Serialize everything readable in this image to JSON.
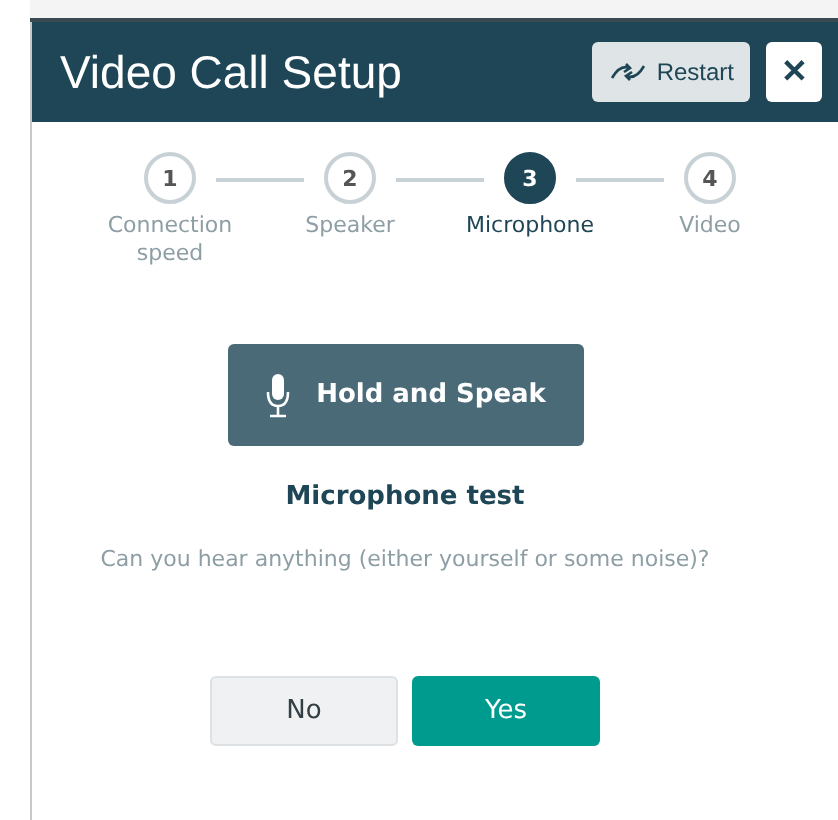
{
  "window": {
    "title": "Video Call Setup"
  },
  "header_buttons": {
    "restart": "Restart",
    "close": "✕"
  },
  "steps": [
    {
      "number": "1",
      "label": "Connection speed",
      "selected": false
    },
    {
      "number": "2",
      "label": "Speaker",
      "selected": false
    },
    {
      "number": "3",
      "label": "Microphone",
      "selected": true
    },
    {
      "number": "4",
      "label": "Video",
      "selected": false
    }
  ],
  "record_button": "Hold and Speak",
  "test_title": "Microphone test",
  "question": "Can you hear anything (either yourself or some noise)?",
  "answers": [
    {
      "label": "No",
      "kind": "secondary"
    },
    {
      "label": "Yes",
      "kind": "primary"
    }
  ]
}
